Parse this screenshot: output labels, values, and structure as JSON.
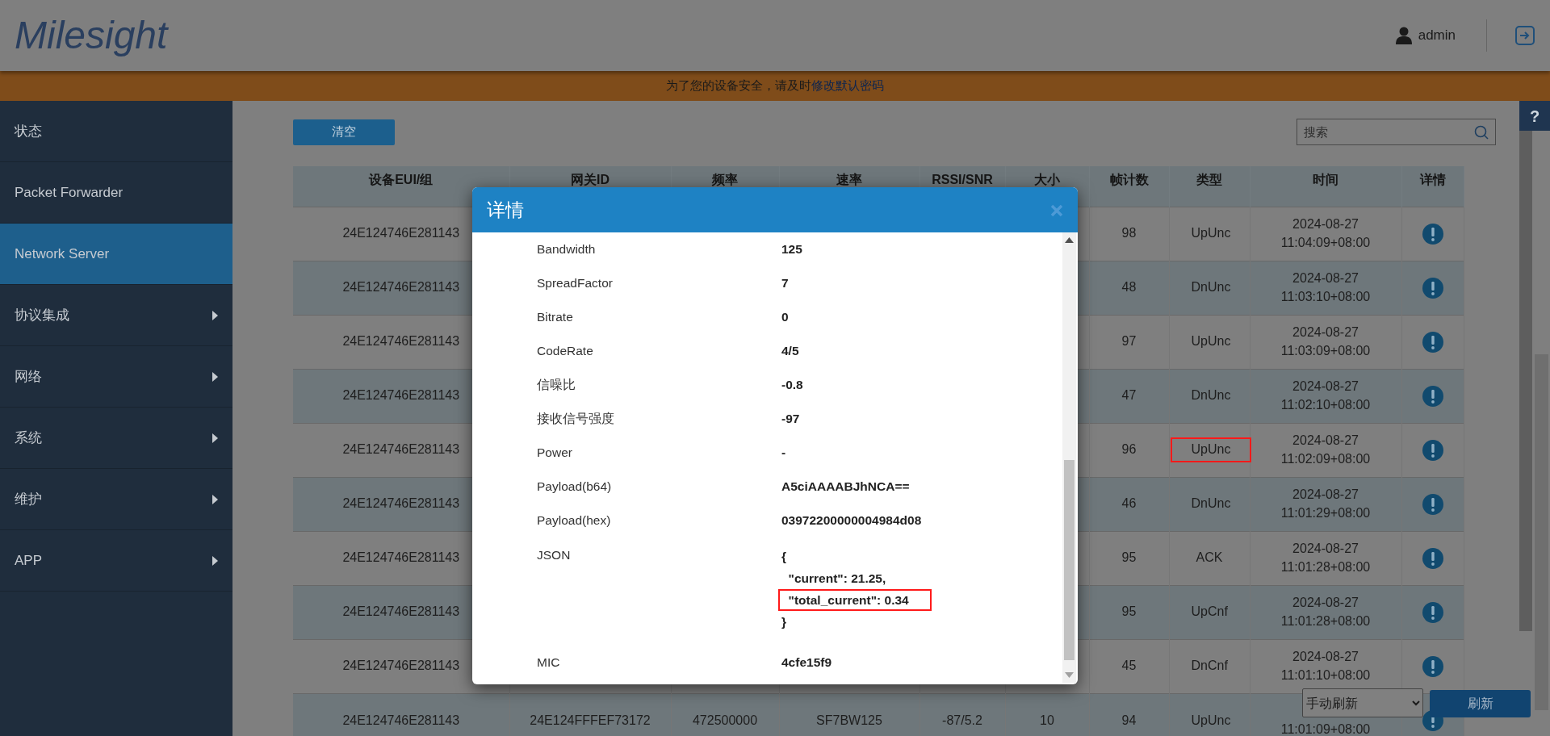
{
  "header": {
    "logo": "Milesight",
    "user": "admin"
  },
  "banner": {
    "text": "为了您的设备安全，请及时",
    "link": "修改默认密码"
  },
  "help_tab": "?",
  "sidebar": {
    "items": [
      {
        "label": "状态",
        "selected": false,
        "has_submenu": false
      },
      {
        "label": "Packet Forwarder",
        "selected": false,
        "has_submenu": false
      },
      {
        "label": "Network Server",
        "selected": true,
        "has_submenu": false
      },
      {
        "label": "协议集成",
        "selected": false,
        "has_submenu": true
      },
      {
        "label": "网络",
        "selected": false,
        "has_submenu": true
      },
      {
        "label": "系统",
        "selected": false,
        "has_submenu": true
      },
      {
        "label": "维护",
        "selected": false,
        "has_submenu": true
      },
      {
        "label": "APP",
        "selected": false,
        "has_submenu": true
      }
    ]
  },
  "toolbar": {
    "clear_button": "清空",
    "search": {
      "placeholder": "搜索"
    }
  },
  "table": {
    "columns": [
      "设备EUI/组",
      "网关ID",
      "频率",
      "速率",
      "RSSI/SNR",
      "大小",
      "帧计数",
      "类型",
      "时间",
      "详情"
    ],
    "rows": [
      {
        "device_eui": "24E124746E281143",
        "frame_count": "98",
        "type": "UpUnc",
        "type_highlighted": false,
        "date": "2024-08-27",
        "time": "11:04:09+08:00"
      },
      {
        "device_eui": "24E124746E281143",
        "frame_count": "48",
        "type": "DnUnc",
        "type_highlighted": false,
        "date": "2024-08-27",
        "time": "11:03:10+08:00"
      },
      {
        "device_eui": "24E124746E281143",
        "frame_count": "97",
        "type": "UpUnc",
        "type_highlighted": false,
        "date": "2024-08-27",
        "time": "11:03:09+08:00"
      },
      {
        "device_eui": "24E124746E281143",
        "frame_count": "47",
        "type": "DnUnc",
        "type_highlighted": false,
        "date": "2024-08-27",
        "time": "11:02:10+08:00"
      },
      {
        "device_eui": "24E124746E281143",
        "frame_count": "96",
        "type": "UpUnc",
        "type_highlighted": true,
        "date": "2024-08-27",
        "time": "11:02:09+08:00"
      },
      {
        "device_eui": "24E124746E281143",
        "frame_count": "46",
        "type": "DnUnc",
        "type_highlighted": false,
        "date": "2024-08-27",
        "time": "11:01:29+08:00"
      },
      {
        "device_eui": "24E124746E281143",
        "frame_count": "95",
        "type": "ACK",
        "type_highlighted": false,
        "date": "2024-08-27",
        "time": "11:01:28+08:00"
      },
      {
        "device_eui": "24E124746E281143",
        "frame_count": "95",
        "type": "UpCnf",
        "type_highlighted": false,
        "date": "2024-08-27",
        "time": "11:01:28+08:00"
      },
      {
        "device_eui": "24E124746E281143",
        "frame_count": "45",
        "type": "DnCnf",
        "type_highlighted": false,
        "date": "2024-08-27",
        "time": "11:01:10+08:00"
      },
      {
        "device_eui": "24E124746E281143",
        "gateway_id": "24E124FFFEF73172",
        "frequency": "472500000",
        "rate": "SF7BW125",
        "rssi_snr": "-87/5.2",
        "size": "10",
        "frame_count": "94",
        "type": "UpUnc",
        "type_highlighted": false,
        "time": "11:01:09+08:00"
      }
    ]
  },
  "refresh": {
    "mode": "手动刷新",
    "button": "刷新"
  },
  "modal": {
    "title": "详情",
    "fields": [
      {
        "label": "Bandwidth",
        "value": "125"
      },
      {
        "label": "SpreadFactor",
        "value": "7"
      },
      {
        "label": "Bitrate",
        "value": "0"
      },
      {
        "label": "CodeRate",
        "value": "4/5"
      },
      {
        "label": "信噪比",
        "value": "-0.8"
      },
      {
        "label": "接收信号强度",
        "value": "-97"
      },
      {
        "label": "Power",
        "value": "-"
      },
      {
        "label": "Payload(b64)",
        "value": "A5ciAAAABJhNCA=="
      },
      {
        "label": "Payload(hex)",
        "value": "03972200000004984d08"
      },
      {
        "label": "JSON",
        "lines": [
          {
            "text": "{",
            "highlighted": false
          },
          {
            "text": "  \"current\": 21.25,",
            "highlighted": false
          },
          {
            "text": "  \"total_current\": 0.34",
            "highlighted": true
          },
          {
            "text": "}",
            "highlighted": false
          }
        ]
      },
      {
        "label": "MIC",
        "value": "4cfe15f9"
      }
    ]
  }
}
